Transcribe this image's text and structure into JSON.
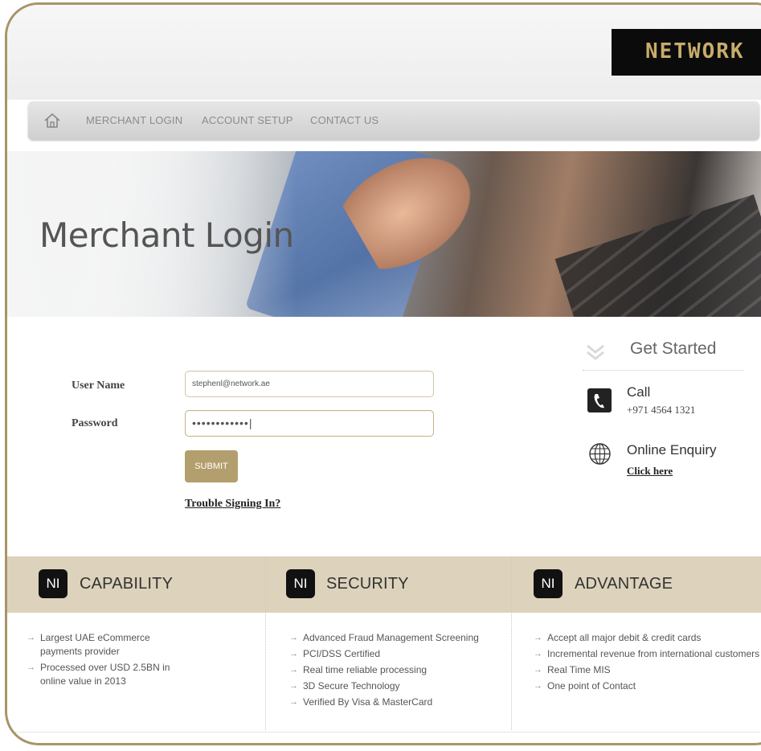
{
  "header": {
    "logo_text": "NETWORK"
  },
  "nav": {
    "items": [
      {
        "label": "MERCHANT LOGIN"
      },
      {
        "label": "ACCOUNT SETUP"
      },
      {
        "label": "CONTACT US"
      }
    ]
  },
  "hero": {
    "title": "Merchant Login"
  },
  "login": {
    "username_label": "User Name",
    "username_value": "stephenl@network.ae",
    "password_label": "Password",
    "password_value": "••••••••••••|",
    "submit_label": "SUBMIT",
    "trouble_link": "Trouble Signing In?"
  },
  "get_started": {
    "title": "Get Started",
    "call_title": "Call",
    "call_number": "+971 4564 1321",
    "enquiry_title": "Online Enquiry",
    "enquiry_link": "Click here"
  },
  "features": [
    {
      "badge": "NI",
      "title": "CAPABILITY",
      "items": [
        "Largest UAE eCommerce payments provider",
        "Processed over USD 2.5BN in online value in 2013"
      ]
    },
    {
      "badge": "NI",
      "title": "SECURITY",
      "items": [
        "Advanced Fraud Management Screening",
        "PCI/DSS Certified",
        "Real time reliable processing",
        "3D Secure Technology",
        "Verified By Visa & MasterCard"
      ]
    },
    {
      "badge": "NI",
      "title": "ADVANTAGE",
      "items": [
        "Accept all major debit & credit cards",
        "Incremental revenue from international customers",
        "Real Time MIS",
        "One point of Contact"
      ]
    }
  ],
  "colors": {
    "accent": "#b39f6d",
    "frame_border": "#a89466",
    "feature_bar": "#ddd2bb"
  }
}
